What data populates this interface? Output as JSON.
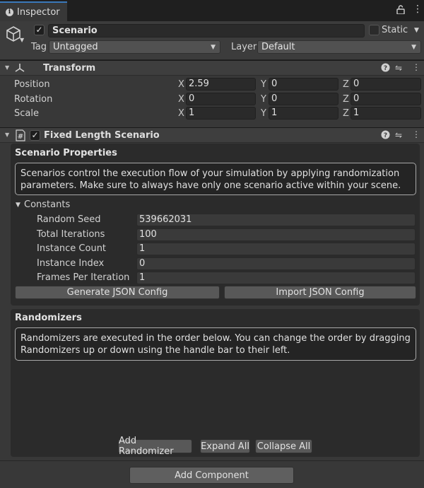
{
  "window": {
    "tab_title": "Inspector"
  },
  "header": {
    "object_name": "Scenario",
    "static_label": "Static",
    "tag_label": "Tag",
    "tag_value": "Untagged",
    "layer_label": "Layer",
    "layer_value": "Default"
  },
  "transform": {
    "title": "Transform",
    "rows": [
      {
        "label": "Position",
        "x": "2.59",
        "y": "0",
        "z": "0"
      },
      {
        "label": "Rotation",
        "x": "0",
        "y": "0",
        "z": "0"
      },
      {
        "label": "Scale",
        "x": "1",
        "y": "1",
        "z": "1"
      }
    ],
    "axis": {
      "x": "X",
      "y": "Y",
      "z": "Z"
    }
  },
  "scenario": {
    "title": "Fixed Length Scenario",
    "props_title": "Scenario Properties",
    "props_help": "Scenarios control the execution flow of your simulation by applying randomization parameters. Make sure to always have only one scenario active within your scene.",
    "constants_label": "Constants",
    "constants": [
      {
        "label": "Random Seed",
        "value": "539662031"
      },
      {
        "label": "Total Iterations",
        "value": "100"
      },
      {
        "label": "Instance Count",
        "value": "1"
      },
      {
        "label": "Instance Index",
        "value": "0"
      },
      {
        "label": "Frames Per Iteration",
        "value": "1"
      }
    ],
    "generate_json": "Generate JSON Config",
    "import_json": "Import JSON Config",
    "randomizers_title": "Randomizers",
    "randomizers_help": "Randomizers are executed in the order below. You can change the order by dragging Randomizers up or down using the handle bar to their left.",
    "add_randomizer": "Add Randomizer",
    "expand_all": "Expand All",
    "collapse_all": "Collapse All"
  },
  "footer": {
    "add_component": "Add Component"
  },
  "icons": {
    "info": "info-icon",
    "lock": "lock-icon",
    "menu": "kebab-menu-icon",
    "cube": "gameobject-cube-icon",
    "transform": "transform-axes-icon",
    "script": "script-hash-icon",
    "help": "help-icon",
    "presets": "presets-icon",
    "more": "more-icon"
  },
  "colors": {
    "tab_accent": "#3a79bb",
    "background": "#383838",
    "panel": "#2b2b2b"
  }
}
